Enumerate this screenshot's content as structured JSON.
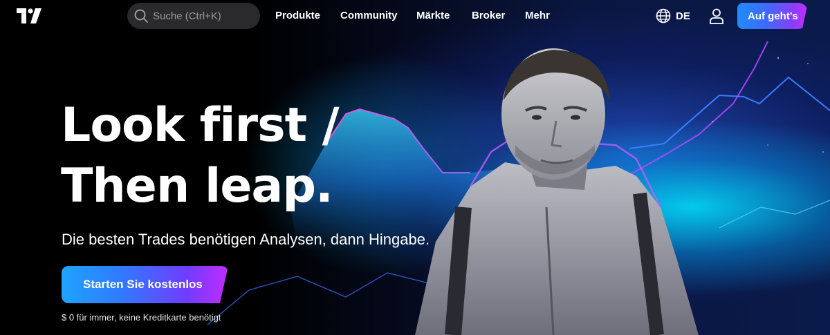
{
  "header": {
    "search": {
      "placeholder": "Suche (Ctrl+K)"
    },
    "nav": [
      {
        "label": "Produkte"
      },
      {
        "label": "Community"
      },
      {
        "label": "Märkte"
      },
      {
        "label": "Broker"
      },
      {
        "label": "Mehr"
      }
    ],
    "language": "DE",
    "cta_label": "Auf geht's"
  },
  "hero": {
    "headline_line1": "Look first /",
    "headline_line2": "Then leap.",
    "subtitle": "Die besten Trades benötigen Analysen, dann Hingabe.",
    "cta_label": "Starten Sie kostenlos",
    "fineprint": "$ 0 für immer, keine Kreditkarte benötigt"
  },
  "icons": {
    "logo": "tradingview-logo",
    "search": "search-icon",
    "language": "globe-icon",
    "account": "user-icon"
  },
  "colors": {
    "background": "#000000",
    "accent_blue": "#2f7bff",
    "accent_purple": "#c02cff",
    "glow_cyan": "#00e5ff"
  }
}
